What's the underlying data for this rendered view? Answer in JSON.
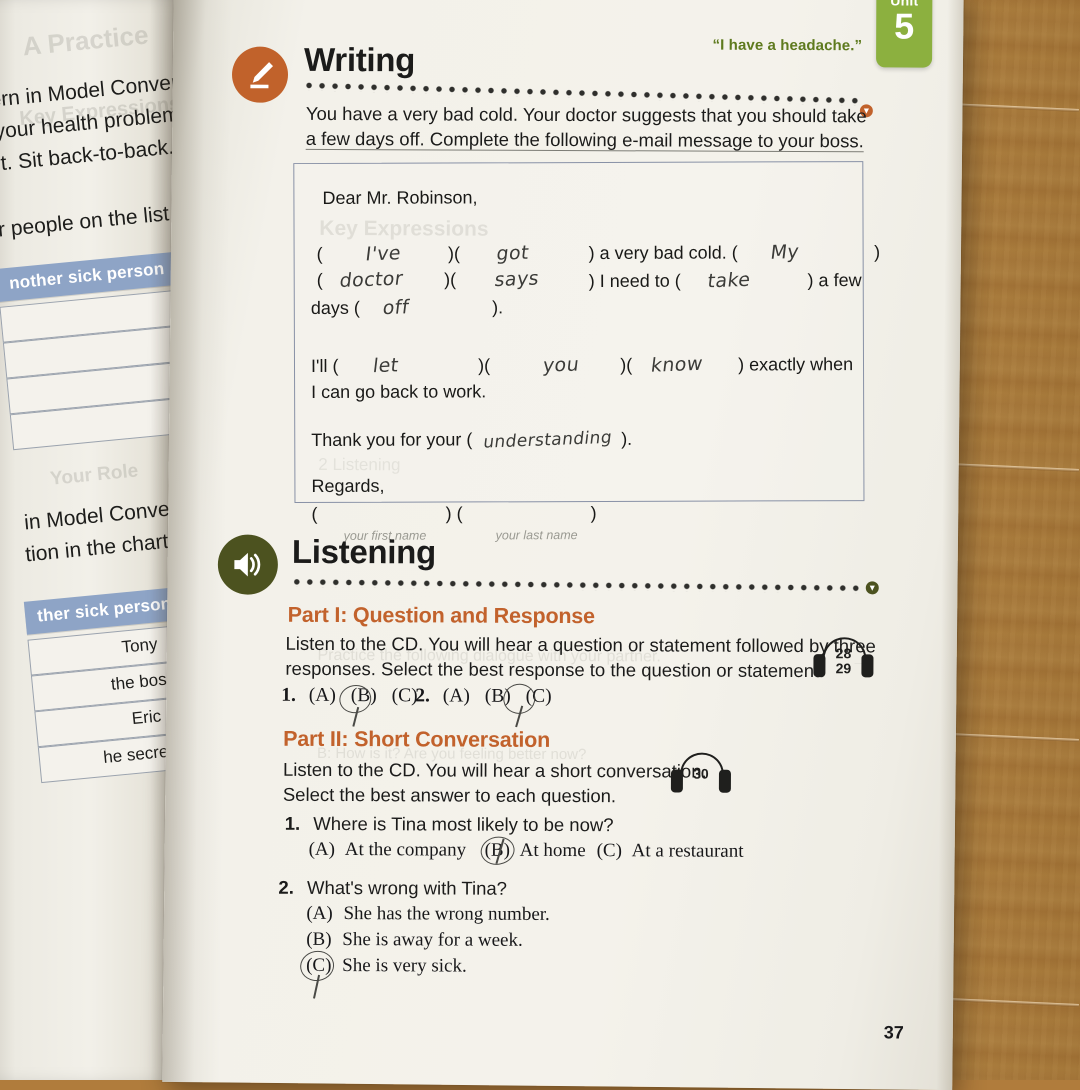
{
  "book": {
    "unit_tab": {
      "label": "Unit",
      "number": "5",
      "color": "#8cb03f"
    },
    "running_head": "“I have a headache.”",
    "page_number": "37",
    "accent_orange": "#c2622c",
    "icon_writing_color": "#c1622b",
    "icon_listening_color": "#4c521f"
  },
  "left_page": {
    "lines": [
      "ern in Model Conversation",
      "your health problem.",
      "rt. Sit back-to-back.",
      "r people on the list and",
      "in Model Conversation",
      "tion in the chart"
    ],
    "bold_fragments": [
      "Model Conversation"
    ],
    "table_1": {
      "header": "nother sick person",
      "rows": [
        "",
        "",
        "",
        ""
      ]
    },
    "table_2": {
      "header": "ther sick person",
      "rows": [
        "Tony",
        "the boss",
        "Eric",
        "he secretary"
      ]
    }
  },
  "writing": {
    "icon": "pencil-icon",
    "title": "Writing",
    "instruction_line_1": "You have a very bad cold. Your doctor suggests that you should take",
    "instruction_line_2": "a few days off. Complete the following e-mail message to your boss.",
    "letter": {
      "salutation": "Dear Mr. Robinson,",
      "line1_prefix": "(",
      "blank_1": "I've",
      "blank_2": "got",
      "after_2": ") a very bad cold. (",
      "blank_3": "My",
      "blank_4": "doctor",
      "blank_5": "says",
      "after_5": ") I need to (",
      "blank_6": "take",
      "after_6": ") a few",
      "days_label": "days (",
      "blank_7": "off",
      "after_7": ").",
      "ill_label": "I'll (",
      "blank_8": "let",
      "blank_9": "you",
      "blank_10": "know",
      "after_10": ") exactly when",
      "last_line": "I can go back to work.",
      "thanks_prefix": "Thank you for your (",
      "blank_11": "understanding",
      "thanks_suffix": ").",
      "regards": "Regards,",
      "hint_first_name": "your first name",
      "hint_last_name": "your last name"
    }
  },
  "listening": {
    "icon": "speaker-icon",
    "title": "Listening",
    "part1": {
      "title": "Part I: Question and Response",
      "instruction_line_1": "Listen to the CD. You will hear a question or statement followed by three",
      "instruction_line_2": "responses. Select the best response to the question or statement.",
      "track": "28\n29",
      "track_line_1": "28",
      "track_line_2": "29",
      "items": [
        {
          "number": "1.",
          "options": [
            "(A)",
            "(B)",
            "(C)"
          ],
          "marked": "(B)"
        },
        {
          "number": "2.",
          "options": [
            "(A)",
            "(B)",
            "(C)"
          ],
          "marked": "(C)"
        }
      ]
    },
    "part2": {
      "title": "Part II: Short Conversation",
      "instruction_line_1": "Listen to the CD. You will hear a short conversation.",
      "instruction_line_2": "Select the best answer to each question.",
      "track_line_1": "30",
      "questions": [
        {
          "number": "1.",
          "text": "Where is Tina most likely to be now?",
          "inline": true,
          "options": [
            {
              "tag": "(A)",
              "text": "At the company",
              "marked": false
            },
            {
              "tag": "(B)",
              "text": "At home",
              "marked": true
            },
            {
              "tag": "(C)",
              "text": "At a restaurant",
              "marked": false
            }
          ]
        },
        {
          "number": "2.",
          "text": "What's wrong with Tina?",
          "inline": false,
          "options": [
            {
              "tag": "(A)",
              "text": "She has the wrong number.",
              "marked": false
            },
            {
              "tag": "(B)",
              "text": "She is away for a week.",
              "marked": false
            },
            {
              "tag": "(C)",
              "text": "She is very sick.",
              "marked": true
            }
          ]
        }
      ]
    }
  }
}
